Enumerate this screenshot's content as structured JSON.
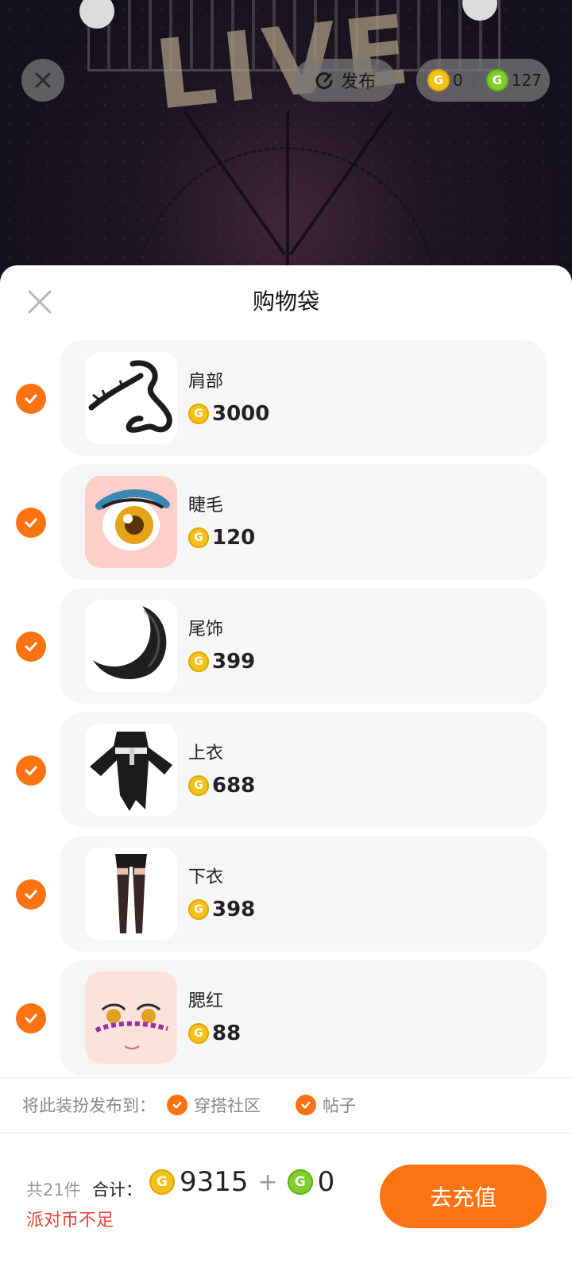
{
  "top_bar": {
    "publish_label": "发布",
    "gold_balance": "0",
    "green_balance": "127"
  },
  "sheet": {
    "title": "购物袋",
    "items": [
      {
        "name": "肩部",
        "price": "3000",
        "checked": true
      },
      {
        "name": "睫毛",
        "price": "120",
        "checked": true
      },
      {
        "name": "尾饰",
        "price": "399",
        "checked": true
      },
      {
        "name": "上衣",
        "price": "688",
        "checked": true
      },
      {
        "name": "下衣",
        "price": "398",
        "checked": true
      },
      {
        "name": "腮红",
        "price": "88",
        "checked": true
      }
    ],
    "publish_to": {
      "label": "将此装扮发布到：",
      "options": [
        {
          "label": "穿搭社区",
          "checked": true
        },
        {
          "label": "帖子",
          "checked": true
        }
      ]
    },
    "footer": {
      "count": "共21件",
      "total_label": "合计：",
      "gold_total": "9315",
      "plus": "+",
      "green_total": "0",
      "warning": "派对币不足",
      "recharge_label": "去充值"
    }
  },
  "colors": {
    "accent": "#fd7312",
    "warning": "#e8433a",
    "coin_gold": "#f5c21c",
    "coin_green": "#7fcf2a"
  },
  "icons": {
    "close": "close-icon",
    "publish": "refresh-arrow-icon",
    "check": "checkmark-icon",
    "coin_gold": "party-coin-icon",
    "coin_green": "green-coin-icon"
  }
}
